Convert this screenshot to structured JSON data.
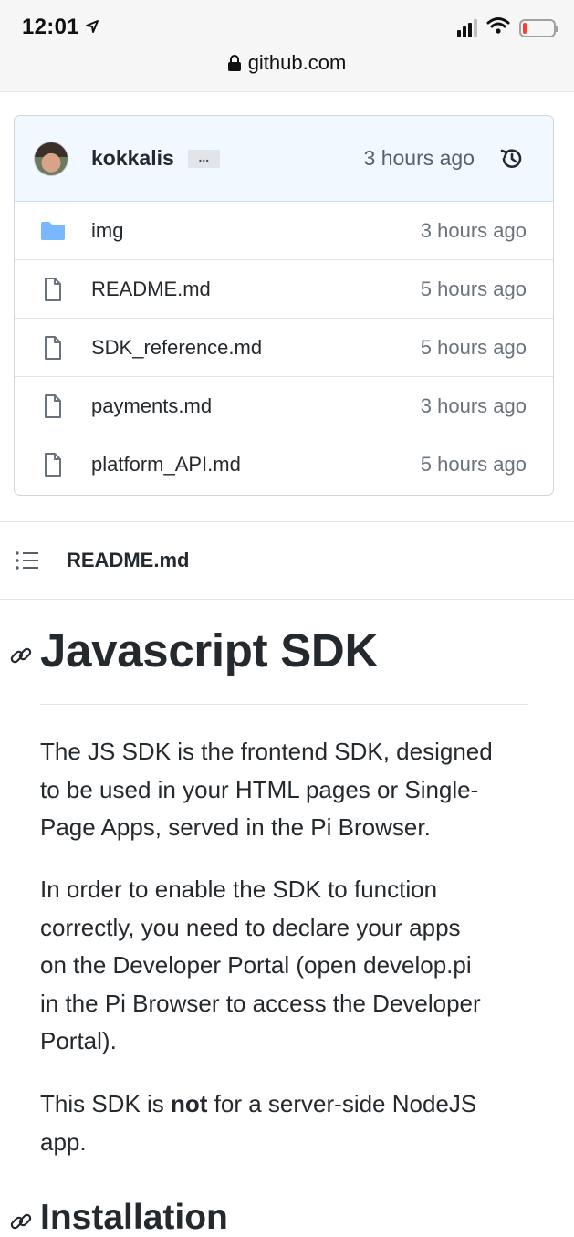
{
  "status_bar": {
    "time": "12:01"
  },
  "url_bar": {
    "domain": "github.com"
  },
  "commit": {
    "author": "kokkalis",
    "ellipsis": "...",
    "time": "3 hours ago"
  },
  "files": [
    {
      "name": "img",
      "type": "folder",
      "age": "3 hours ago"
    },
    {
      "name": "README.md",
      "type": "file",
      "age": "5 hours ago"
    },
    {
      "name": "SDK_reference.md",
      "type": "file",
      "age": "5 hours ago"
    },
    {
      "name": "payments.md",
      "type": "file",
      "age": "3 hours ago"
    },
    {
      "name": "platform_API.md",
      "type": "file",
      "age": "5 hours ago"
    }
  ],
  "readme": {
    "title": "README.md",
    "h1": "Javascript SDK",
    "p1": {
      "line1": "The JS SDK is the frontend SDK, designed",
      "line2": "to be used in your HTML pages or Single-",
      "line3": "Page Apps, served in the Pi Browser."
    },
    "p2": {
      "line1": "In order to enable the SDK to function",
      "line2": "correctly, you need to declare your apps",
      "line3": "on the Developer Portal (open develop.pi",
      "line4": "in the Pi Browser to access the Developer",
      "line5": "Portal)."
    },
    "p3": {
      "before": "This SDK is ",
      "bold": "not",
      "after": " for a server-side NodeJS",
      "line2": "app."
    },
    "h2": "Installation"
  },
  "colors": {
    "commit_bg": "#f1f8ff",
    "folder_icon": "#79b8ff",
    "text": "#24292e",
    "muted": "#6a737d",
    "battery_low": "#ff3b30"
  }
}
